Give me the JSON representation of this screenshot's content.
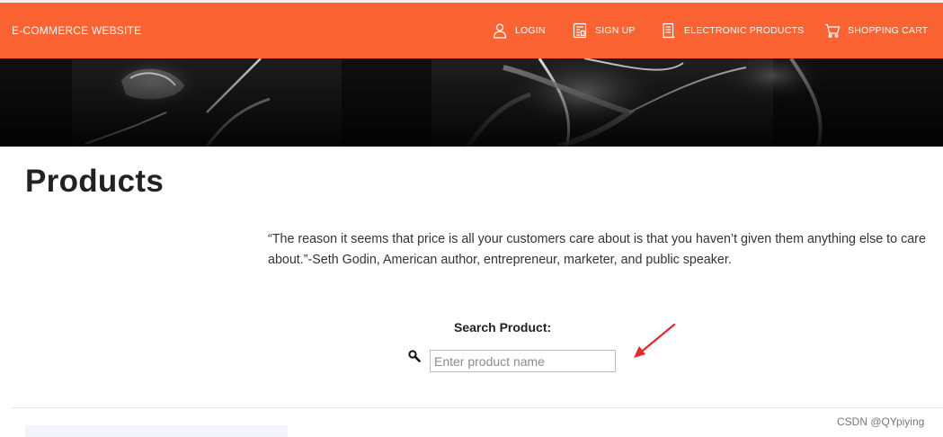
{
  "nav": {
    "brand": "E-COMMERCE WEBSITE",
    "items": [
      {
        "label": "LOGIN",
        "icon": "user-icon"
      },
      {
        "label": "SIGN UP",
        "icon": "register-icon"
      },
      {
        "label": "ELECTRONIC PRODUCTS",
        "icon": "document-icon"
      },
      {
        "label": "SHOPPING CART",
        "icon": "cart-icon"
      }
    ],
    "background_color": "#fc6333",
    "text_color": "#ffffff"
  },
  "page": {
    "title": "Products",
    "quote_line1": "“The reason it seems that price is all your customers care about is that you haven’t given them anything else to care",
    "quote_line2": "about.”-Seth Godin, American author, entrepreneur, marketer, and public speaker."
  },
  "search": {
    "label": "Search Product:",
    "placeholder": "Enter product name",
    "value": "",
    "icon": "magnifier-icon"
  },
  "annotation": {
    "icon": "red-arrow-icon",
    "color": "#e8272a"
  },
  "watermark": "CSDN @QYpiying"
}
